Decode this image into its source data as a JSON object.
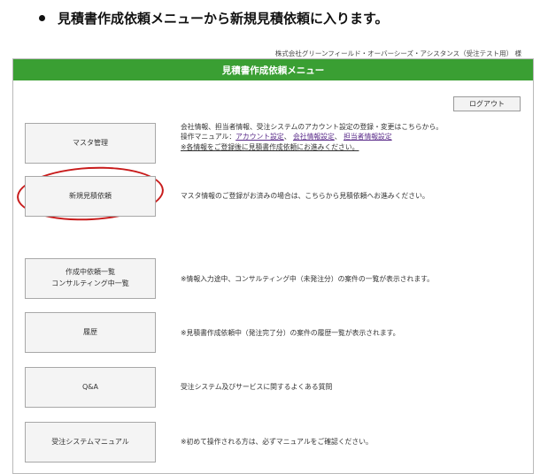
{
  "instruction": "見積書作成依頼メニューから新規見積依頼に入ります。",
  "company": "株式会社グリーンフィールド・オーバーシーズ・アシスタンス（受注テスト用） 様",
  "header": {
    "title": "見積書作成依頼メニュー"
  },
  "logout_label": "ログアウト",
  "menu": {
    "master": {
      "label": "マスタ管理",
      "desc_line1": "会社情報、担当者情報、受注システムのアカウント設定の登録・変更はこちらから。",
      "desc_line2_prefix": "操作マニュアル：",
      "link_account": "アカウント設定",
      "link_company": "会社情報設定",
      "link_staff": "担当者情報設定",
      "sep": "、",
      "note": "※各情報をご登録後に見積書作成依頼にお進みください。"
    },
    "new_estimate": {
      "label": "新規見積依頼",
      "desc": "マスタ情報のご登録がお済みの場合は、こちらから見積依頼へお進みください。"
    },
    "in_progress": {
      "label_line1": "作成中依頼一覧",
      "label_line2": "コンサルティング中一覧",
      "desc": "※情報入力途中、コンサルティング中（未発注分）の案件の一覧が表示されます。"
    },
    "history": {
      "label": "履歴",
      "desc": "※見積書作成依頼中（発注完了分）の案件の履歴一覧が表示されます。"
    },
    "qa": {
      "label": "Q&A",
      "desc": "受注システム及びサービスに関するよくある質問"
    },
    "manual": {
      "label": "受注システムマニュアル",
      "desc": "※初めて操作される方は、必ずマニュアルをご確認ください。"
    }
  },
  "colors": {
    "header_green": "#3a9f33",
    "highlight_red": "#c81b1b",
    "link_purple": "#5b2c8a"
  }
}
